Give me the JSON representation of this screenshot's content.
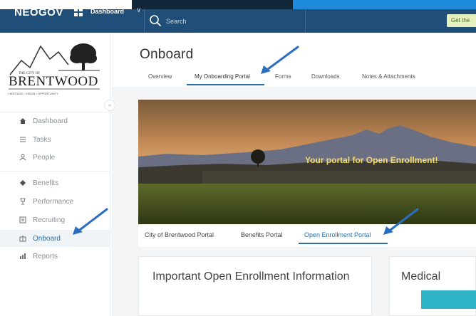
{
  "navbar": {
    "brand": "NEOGOV",
    "app_dropdown": "Dashboard",
    "search_placeholder": "Search",
    "cta_label": "Get the"
  },
  "sidebar": {
    "org_logo_text": "THE CITY OF BRENTWOOD",
    "items": [
      {
        "label": "Dashboard",
        "icon": "home-icon"
      },
      {
        "label": "Tasks",
        "icon": "tasks-icon"
      },
      {
        "label": "People",
        "icon": "people-icon"
      },
      {
        "label": "Benefits",
        "icon": "benefits-icon"
      },
      {
        "label": "Performance",
        "icon": "trophy-icon"
      },
      {
        "label": "Recruiting",
        "icon": "recruiting-icon"
      },
      {
        "label": "Onboard",
        "icon": "onboard-icon"
      },
      {
        "label": "Reports",
        "icon": "reports-icon"
      }
    ],
    "active_item": "Onboard"
  },
  "page": {
    "title": "Onboard",
    "tabs": [
      "Overview",
      "My Onboarding Portal",
      "Forms",
      "Downloads",
      "Notes & Attachments"
    ],
    "active_tab": "My Onboarding Portal"
  },
  "banner": {
    "text": "Your portal for Open Enrollment!"
  },
  "portal_tabs": {
    "items": [
      "City of Brentwood Portal",
      "Benefits Portal",
      "Open Enrollment Portal"
    ],
    "active": "Open Enrollment Portal"
  },
  "cards": {
    "info_title": "Important Open Enrollment Information",
    "medical_title": "Medical"
  },
  "colors": {
    "nav_bg": "#1f4f78",
    "accent": "#2a6ea6",
    "banner_text": "#f5dc6a",
    "medical_button": "#2fb3c7"
  }
}
